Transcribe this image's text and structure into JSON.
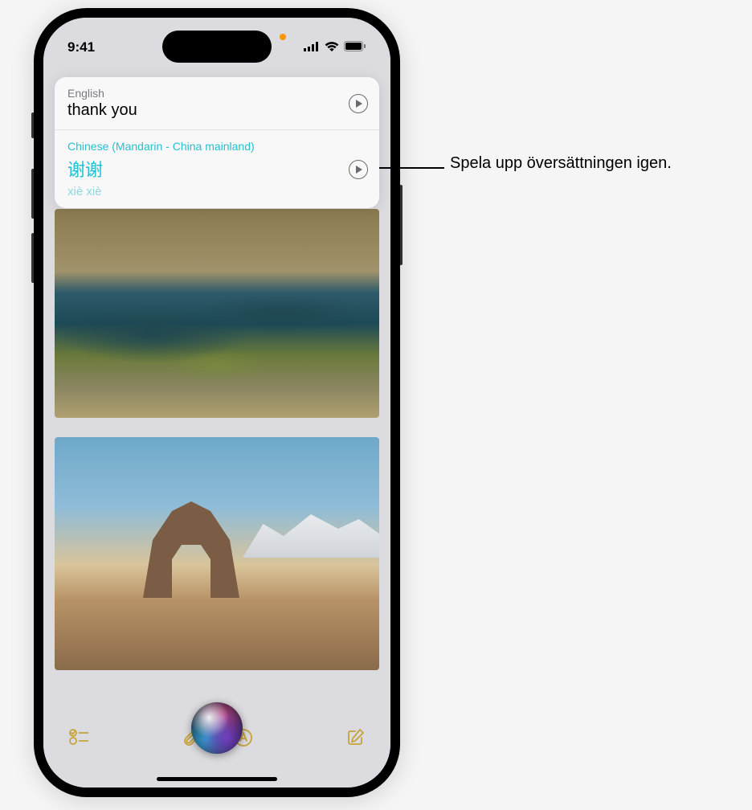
{
  "status": {
    "time": "9:41"
  },
  "translation": {
    "source": {
      "lang": "English",
      "text": "thank you"
    },
    "target": {
      "lang": "Chinese (Mandarin - China mainland)",
      "chars": "谢谢",
      "pinyin": "xiè xiè"
    }
  },
  "callout": {
    "text": "Spela upp översättningen igen."
  }
}
